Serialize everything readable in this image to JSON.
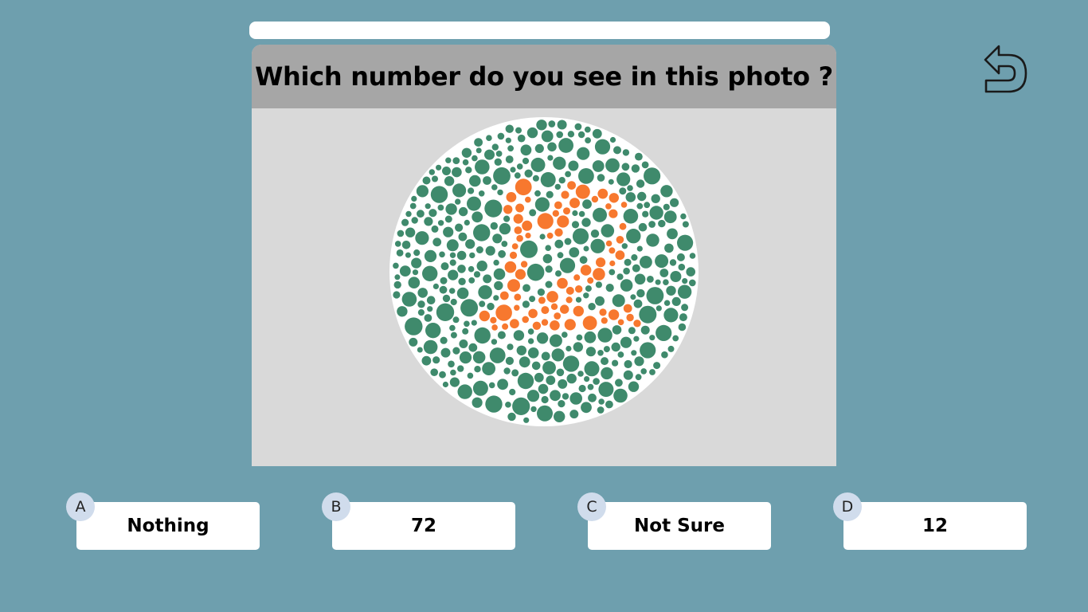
{
  "quiz": {
    "progress": 0,
    "question": "Which number do you see in this photo ?",
    "plate": {
      "dot_color": "#3f8a6c",
      "figure_color": "#f7782e",
      "hidden_number": "12"
    },
    "options": [
      {
        "letter": "A",
        "text": "Nothing"
      },
      {
        "letter": "B",
        "text": "72"
      },
      {
        "letter": "C",
        "text": "Not Sure"
      },
      {
        "letter": "D",
        "text": "12"
      }
    ]
  },
  "colors": {
    "background": "#6e9fae",
    "header": "#a6a6a6",
    "card": "#d9d9d9",
    "badge": "#d0dcec"
  },
  "icons": {
    "back": "undo-arrow-icon"
  }
}
